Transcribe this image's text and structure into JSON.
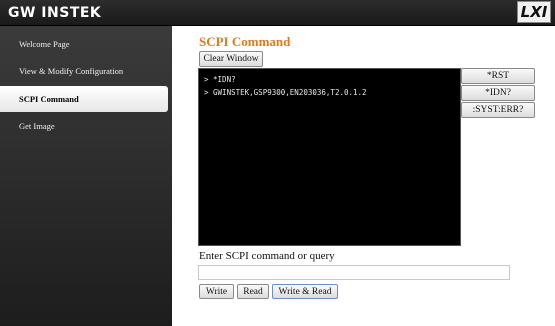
{
  "header": {
    "brand": "GW INSTEK",
    "lxi_logo": "LXI"
  },
  "sidebar": {
    "items": [
      {
        "label": "Welcome Page",
        "active": false
      },
      {
        "label": "View & Modify Configuration",
        "active": false
      },
      {
        "label": "SCPI Command",
        "active": true
      },
      {
        "label": "Get Image",
        "active": false
      }
    ]
  },
  "main": {
    "title": "SCPI Command",
    "clear_window_label": "Clear Window",
    "console_lines": [
      "> *IDN?",
      "> GWINSTEK,GSP9300,EN203036,T2.0.1.2"
    ],
    "quick_buttons": [
      "*RST",
      "*IDN?",
      ":SYST:ERR?"
    ],
    "input_label": "Enter SCPI command or query",
    "input_value": "",
    "input_placeholder": "",
    "write_label": "Write",
    "read_label": "Read",
    "write_read_label": "Write & Read"
  },
  "colors": {
    "title_accent": "#e07a1c",
    "sidebar_bg": "#2a2a2a",
    "console_bg": "#000000"
  }
}
